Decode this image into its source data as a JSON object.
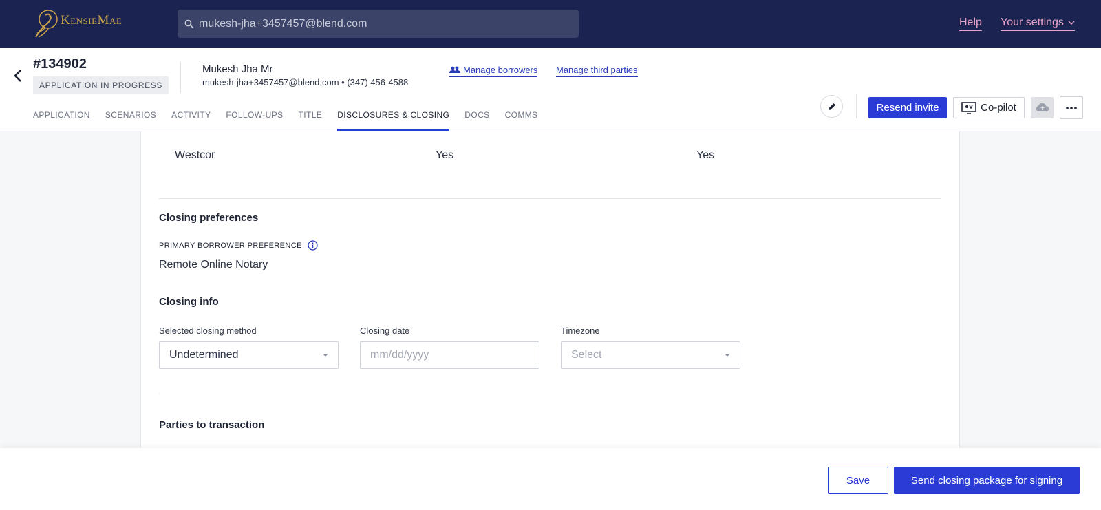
{
  "brand": {
    "logo_text": "KensieMae"
  },
  "search": {
    "value": "mukesh-jha+3457457@blend.com"
  },
  "nav": {
    "help_label": "Help",
    "settings_label": "Your settings"
  },
  "loan": {
    "id": "#134902",
    "status": "APPLICATION IN PROGRESS",
    "borrower_name": "Mukesh Jha Mr",
    "borrower_contact": "mukesh-jha+3457457@blend.com • (347) 456-4588"
  },
  "header_links": {
    "manage_borrowers": "Manage borrowers",
    "manage_third_parties": "Manage third parties"
  },
  "tabs": [
    {
      "label": "APPLICATION"
    },
    {
      "label": "SCENARIOS"
    },
    {
      "label": "ACTIVITY"
    },
    {
      "label": "FOLLOW-UPS"
    },
    {
      "label": "TITLE"
    },
    {
      "label": "DISCLOSURES & CLOSING"
    },
    {
      "label": "DOCS"
    },
    {
      "label": "COMMS"
    }
  ],
  "actions": {
    "resend_invite": "Resend invite",
    "copilot": "Co-pilot"
  },
  "title_row": {
    "company": "Westcor",
    "col2": "Yes",
    "col3": "Yes"
  },
  "closing_preferences": {
    "title": "Closing preferences",
    "primary_label": "PRIMARY BORROWER PREFERENCE",
    "primary_value": "Remote Online Notary"
  },
  "closing_info": {
    "title": "Closing info",
    "method_label": "Selected closing method",
    "method_value": "Undetermined",
    "date_label": "Closing date",
    "date_placeholder": "mm/dd/yyyy",
    "timezone_label": "Timezone",
    "timezone_value": "Select"
  },
  "parties": {
    "title": "Parties to transaction"
  },
  "footer": {
    "save_label": "Save",
    "send_label": "Send closing package for signing"
  },
  "colors": {
    "nav_bg": "#1b2450",
    "primary": "#2b3bd5",
    "link_pink": "#e6a3c8",
    "logo_gold": "#c9a24a"
  }
}
